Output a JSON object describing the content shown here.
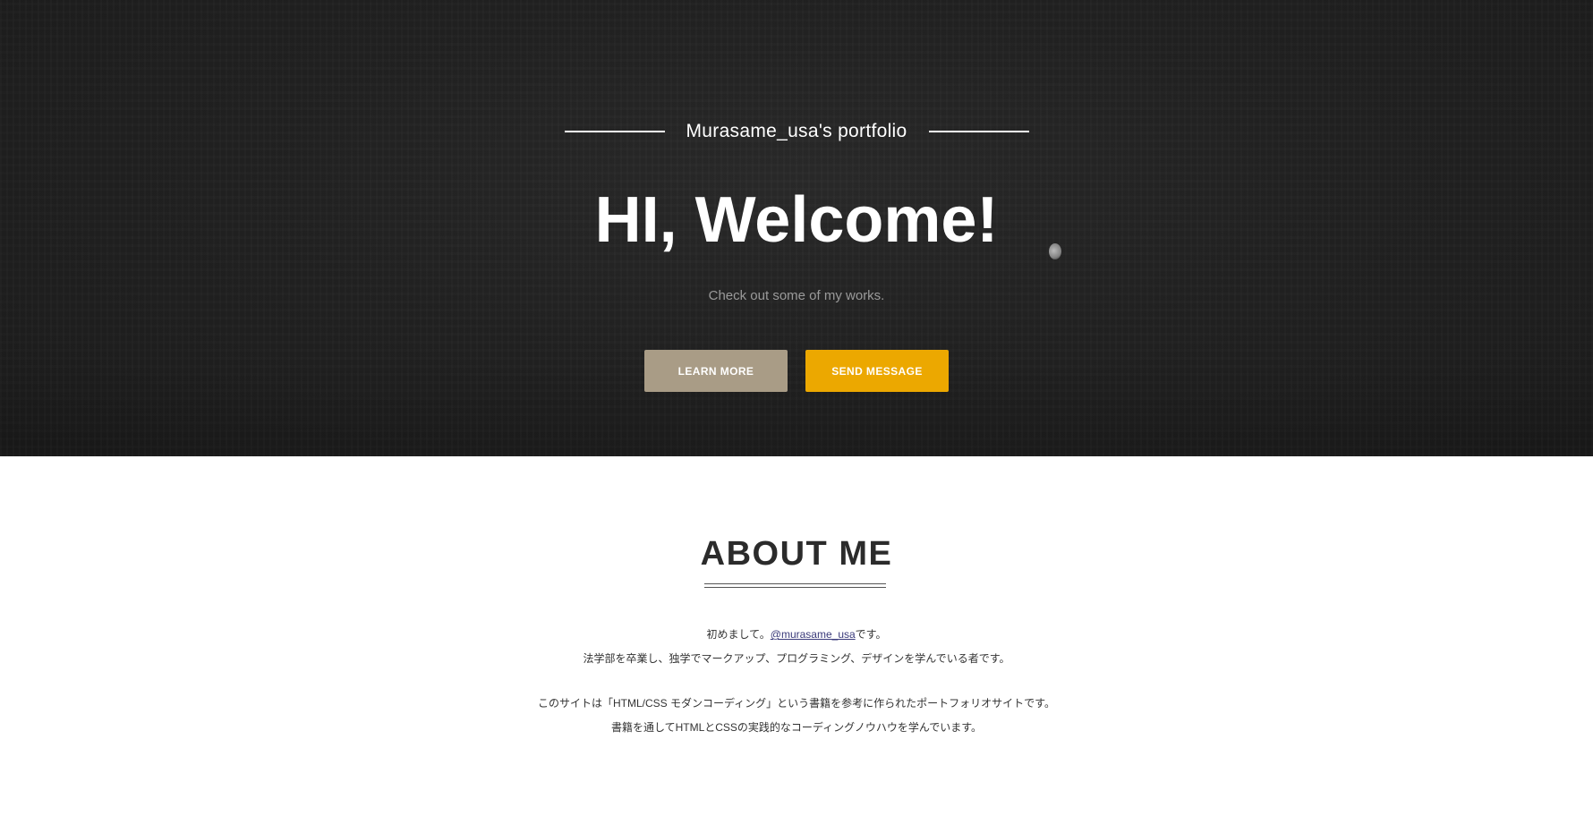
{
  "hero": {
    "subtitle": "Murasame_usa's portfolio",
    "title": "HI, Welcome!",
    "lead": "Check out some of my works.",
    "buttons": {
      "learn_more": "LEARN MORE",
      "send_message": "SEND MESSAGE"
    },
    "colors": {
      "learn_more_bg": "#a99c86",
      "send_message_bg": "#eca800"
    }
  },
  "about": {
    "title": "ABOUT ME",
    "para1": {
      "line1_before": "初めまして。",
      "line1_link": "@murasame_usa",
      "line1_after": "です。",
      "line2": "法学部を卒業し、独学でマークアップ、プログラミング、デザインを学んでいる者です。"
    },
    "para2": {
      "line1": "このサイトは「HTML/CSS モダンコーディング」という書籍を参考に作られたポートフォリオサイトです。",
      "line2": "書籍を通してHTMLとCSSの実践的なコーディングノウハウを学んでいます。"
    }
  }
}
